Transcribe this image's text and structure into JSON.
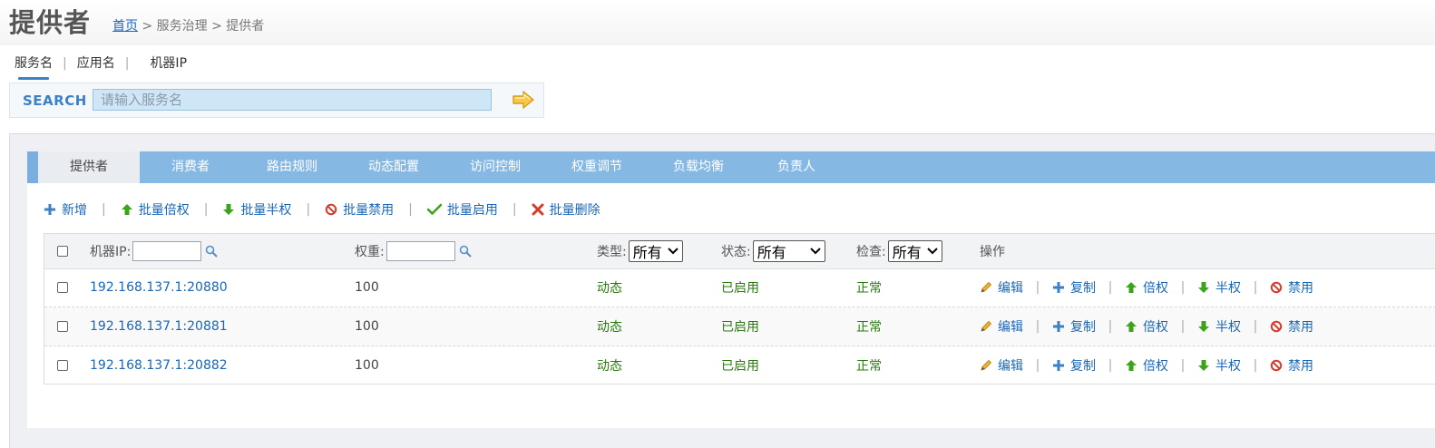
{
  "header": {
    "title": "提供者",
    "breadcrumb": {
      "home": "首页",
      "sep1": " > ",
      "middle": "服务治理",
      "sep2": " > ",
      "current": "提供者"
    }
  },
  "search": {
    "tabs": [
      {
        "label": "服务名",
        "active": true
      },
      {
        "label": "应用名",
        "active": false
      },
      {
        "label": "机器IP",
        "active": false
      }
    ],
    "separator": "|",
    "label": "SEARCH",
    "placeholder": "请输入服务名",
    "value": ""
  },
  "tabs": [
    {
      "label": "提供者",
      "active": true
    },
    {
      "label": "消费者",
      "active": false
    },
    {
      "label": "路由规则",
      "active": false
    },
    {
      "label": "动态配置",
      "active": false
    },
    {
      "label": "访问控制",
      "active": false
    },
    {
      "label": "权重调节",
      "active": false
    },
    {
      "label": "负载均衡",
      "active": false
    },
    {
      "label": "负责人",
      "active": false
    }
  ],
  "toolbar": {
    "separator": "|",
    "add": "新增",
    "batch_double": "批量倍权",
    "batch_half": "批量半权",
    "batch_disable": "批量禁用",
    "batch_enable": "批量启用",
    "batch_delete": "批量删除"
  },
  "table": {
    "headers": {
      "ip": "机器IP:",
      "weight": "权重:",
      "type": "类型:",
      "status": "状态:",
      "check": "检查:",
      "actions": "操作"
    },
    "filters": {
      "type": "所有",
      "status": "所有",
      "check": "所有"
    },
    "row_actions": {
      "edit": "编辑",
      "copy": "复制",
      "double": "倍权",
      "half": "半权",
      "disable": "禁用",
      "separator": "|"
    },
    "rows": [
      {
        "ip": "192.168.137.1:20880",
        "weight": "100",
        "type": "动态",
        "status": "已启用",
        "check": "正常"
      },
      {
        "ip": "192.168.137.1:20881",
        "weight": "100",
        "type": "动态",
        "status": "已启用",
        "check": "正常"
      },
      {
        "ip": "192.168.137.1:20882",
        "weight": "100",
        "type": "动态",
        "status": "已启用",
        "check": "正常"
      }
    ]
  },
  "colors": {
    "link": "#1a67b8",
    "tabbar": "#86b8e4",
    "status_green": "#2a7a10",
    "search_accent": "#3c80c8",
    "up_arrow": "#3aa51a",
    "disable_red": "#d83a2a",
    "pencil": "#e0a020"
  }
}
